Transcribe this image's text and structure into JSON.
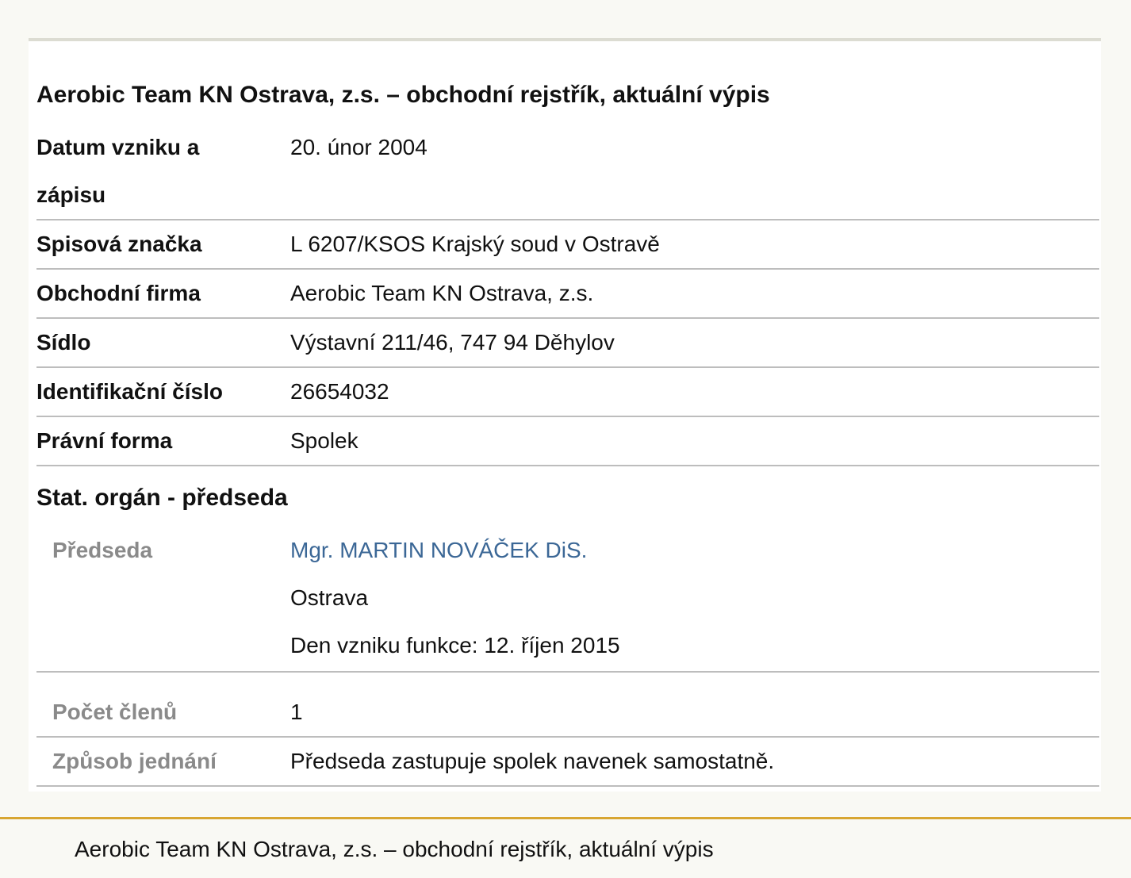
{
  "title": "Aerobic Team KN Ostrava, z.s. – obchodní rejstřík, aktuální výpis",
  "rows": [
    {
      "label": "Datum vzniku a zápisu",
      "value": "20. únor 2004"
    },
    {
      "label": "Spisová značka",
      "value": "L 6207/KSOS Krajský soud v Ostravě"
    },
    {
      "label": "Obchodní firma",
      "value": "Aerobic Team KN Ostrava, z.s."
    },
    {
      "label": "Sídlo",
      "value": "Výstavní 211/46, 747 94 Děhylov"
    },
    {
      "label": "Identifikační číslo",
      "value": "26654032"
    },
    {
      "label": "Právní forma",
      "value": "Spolek"
    }
  ],
  "organ": {
    "heading": "Stat. orgán - předseda",
    "chair": {
      "label": "Předseda",
      "name": "Mgr. MARTIN NOVÁČEK DiS.",
      "city": "Ostrava",
      "since": "Den vzniku funkce: 12. říjen 2015"
    },
    "members": {
      "label": "Počet členů",
      "value": "1"
    },
    "conduct": {
      "label": "Způsob jednání",
      "value": "Předseda zastupuje spolek navenek samostatně."
    }
  },
  "footer": {
    "text": "Aerobic Team KN Ostrava, z.s. – obchodní rejstřík, aktuální výpis"
  },
  "colors": {
    "link": "#3b6796",
    "accent": "#d8a631",
    "sub_label": "#8a8a8a"
  }
}
